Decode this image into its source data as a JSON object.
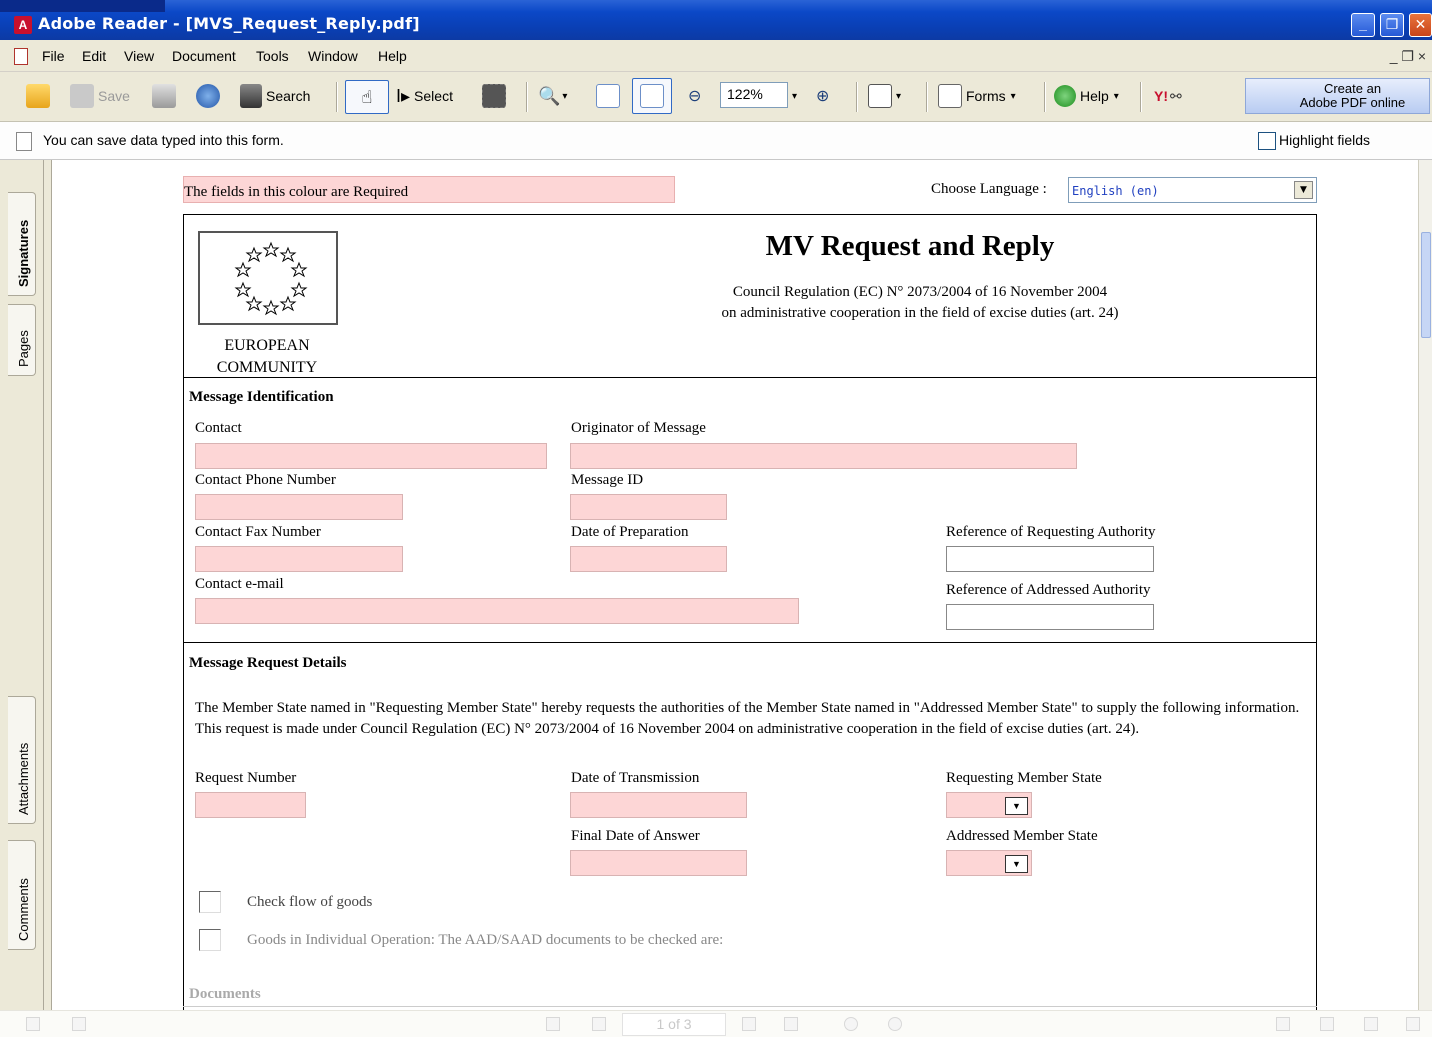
{
  "window": {
    "title": "Adobe Reader - [MVS_Request_Reply.pdf]",
    "minimize": "_",
    "maximize": "❐",
    "close": "✕"
  },
  "menu": {
    "items": [
      "File",
      "Edit",
      "View",
      "Document",
      "Tools",
      "Window",
      "Help"
    ],
    "doc_controls": "_ ❐ ×"
  },
  "toolbar": {
    "save": "Save",
    "search": "Search",
    "select": "Select",
    "zoom": "122%",
    "forms": "Forms",
    "help": "Help",
    "yahoo": "Y!",
    "create_line1": "Create an",
    "create_line2": "Adobe PDF online"
  },
  "message_bar": {
    "text": "You can save data typed into this form.",
    "highlight_label": "Highlight fields"
  },
  "nav_tabs": [
    "Signatures",
    "Pages",
    "Attachments",
    "Comments"
  ],
  "form": {
    "required_legend": "The fields in this colour are Required",
    "language_label": "Choose Language :",
    "language_value": "English (en)",
    "emblem_line1": "EUROPEAN",
    "emblem_line2": "COMMUNITY",
    "title": "MV Request and Reply",
    "subtitle1": "Council Regulation (EC) N° 2073/2004 of 16 November 2004",
    "subtitle2": "on administrative cooperation in the field of excise duties (art. 24)",
    "identification": {
      "heading": "Message Identification",
      "contact": "Contact",
      "originator": "Originator of Message",
      "phone": "Contact Phone Number",
      "message_id": "Message ID",
      "fax": "Contact Fax Number",
      "date_prep": "Date of Preparation",
      "ref_requesting": "Reference of Requesting Authority",
      "email": "Contact e-mail",
      "ref_addressed": "Reference of Addressed Authority"
    },
    "request": {
      "heading": "Message Request Details",
      "paragraph": "The Member State named in \"Requesting Member State\" hereby requests the authorities of the Member State named in \"Addressed Member State\" to supply the following information. This request is made under Council Regulation (EC) N° 2073/2004 of 16 November 2004 on administrative cooperation in the field of excise duties (art. 24).",
      "request_number": "Request Number",
      "date_transmission": "Date of Transmission",
      "requesting_ms": "Requesting Member State",
      "final_date": "Final Date of Answer",
      "addressed_ms": "Addressed Member State",
      "check_flow": "Check flow of goods",
      "goods_individual": "Goods in Individual Operation: The AAD/SAAD documents to be checked are:",
      "documents": "Documents"
    }
  },
  "status": {
    "page": "1 of 3"
  },
  "colors": {
    "required_field": "#fdd6d6",
    "titlebar": "#0a48c6"
  }
}
